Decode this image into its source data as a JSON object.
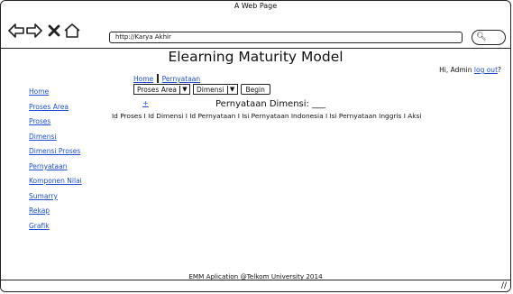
{
  "window": {
    "title": "A Web Page"
  },
  "browser": {
    "address": "http://Karya Akhir",
    "icons": [
      "back-arrow-icon",
      "forward-arrow-icon",
      "close-x-icon",
      "home-icon",
      "search-icon"
    ]
  },
  "page": {
    "title": "Elearning Maturity Model",
    "greeting_prefix": "Hi, Admin",
    "logout_label": "log out",
    "greeting_suffix": "?",
    "breadcrumb": [
      "Home",
      "Pernyataan"
    ],
    "filters": {
      "proses_area": "Proses Area",
      "dimensi": "Dimensi",
      "begin_label": "Begin"
    },
    "add_label": "+",
    "section_heading": "Pernyataan Dimensi: ___",
    "columns_text": "Id Proses I  Id Dimensi I  Id Pernyataan I  Isi Pernyataan Indonesia I  Isi Pernyataan Inggris I  Aksi",
    "footer": "EMM Aplication @Telkom University 2014"
  },
  "sidebar": {
    "items": [
      {
        "label": "Home"
      },
      {
        "label": "Proses Area"
      },
      {
        "label": "Proses"
      },
      {
        "label": "Dimensi"
      },
      {
        "label": "Dimensi Proses"
      },
      {
        "label": "Pernyataan"
      },
      {
        "label": "Komponen Nilai"
      },
      {
        "label": "Sumarry"
      },
      {
        "label": "Rekap"
      },
      {
        "label": "Grafik"
      }
    ]
  }
}
